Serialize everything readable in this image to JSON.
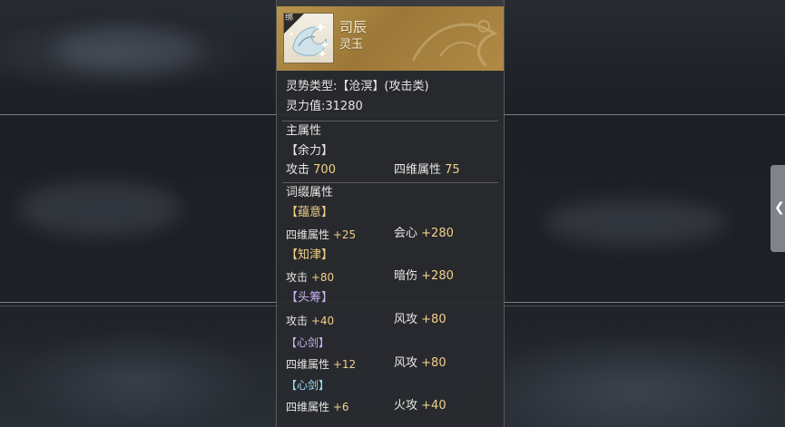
{
  "item": {
    "bound_tag": "绑",
    "name": "司辰",
    "type": "灵玉",
    "spirit_type_label": "灵势类型:",
    "spirit_type_value": "【沧溟】(攻击类)",
    "power_label": "灵力值:",
    "power_value": "31280"
  },
  "main_attributes": {
    "heading": "主属性",
    "group": "【余力】",
    "stats": [
      {
        "label": "攻击",
        "value": "700"
      },
      {
        "label": "四维属性",
        "value": "75"
      }
    ]
  },
  "affix_attributes": {
    "heading": "词缀属性",
    "groups": [
      {
        "name": "【蕴意】",
        "color": "#f2cf86",
        "stats": [
          {
            "label": "四维属性",
            "value": "+25"
          },
          {
            "label": "会心",
            "value": "+280"
          }
        ]
      },
      {
        "name": "【知津】",
        "color": "#f2cf86",
        "stats": [
          {
            "label": "攻击",
            "value": "+80"
          },
          {
            "label": "暗伤",
            "value": "+280"
          }
        ]
      },
      {
        "name": "【头筹】",
        "color": "#c8b2ef",
        "stats": [
          {
            "label": "攻击",
            "value": "+40"
          },
          {
            "label": "风攻",
            "value": "+80"
          }
        ]
      },
      {
        "name": "【心剑】",
        "color": "#c8b2ef",
        "stats": [
          {
            "label": "四维属性",
            "value": "+12"
          },
          {
            "label": "风攻",
            "value": "+80"
          }
        ]
      },
      {
        "name": "【心剑】",
        "color": "#9fdcf2",
        "stats": [
          {
            "label": "四维属性",
            "value": "+6"
          },
          {
            "label": "火攻",
            "value": "+40"
          }
        ]
      }
    ]
  },
  "side_tab": {
    "icon": "chevron-left-icon"
  },
  "colors": {
    "header_gold": "#b8944c",
    "value_gold": "#f2d08a",
    "panel_bg": "#2a2c30"
  }
}
